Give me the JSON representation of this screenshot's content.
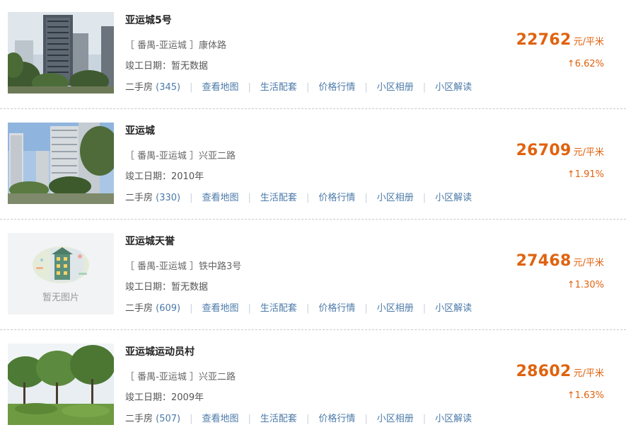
{
  "listings": [
    {
      "name": "亚运城5号",
      "address": "［ 番禺-亚运城 ］康体路",
      "date_label": "竣工日期：暂无数据",
      "price": "22762",
      "unit": "元/平米",
      "change": "↑6.62%",
      "secondhand_label": "二手房",
      "secondhand_count": "(345)",
      "image": "photo-tower"
    },
    {
      "name": "亚运城",
      "address": "［ 番禺-亚运城 ］兴亚二路",
      "date_label": "竣工日期：2010年",
      "price": "26709",
      "unit": "元/平米",
      "change": "↑1.91%",
      "secondhand_label": "二手房",
      "secondhand_count": "(330)",
      "image": "photo-highrises"
    },
    {
      "name": "亚运城天誉",
      "address": "［ 番禺-亚运城 ］铁中路3号",
      "date_label": "竣工日期：暂无数据",
      "price": "27468",
      "unit": "元/平米",
      "change": "↑1.30%",
      "secondhand_label": "二手房",
      "secondhand_count": "(609)",
      "image": "no-image",
      "image_placeholder": "暂无图片"
    },
    {
      "name": "亚运城运动员村",
      "address": "［ 番禺-亚运城 ］兴亚二路",
      "date_label": "竣工日期：2009年",
      "price": "28602",
      "unit": "元/平米",
      "change": "↑1.63%",
      "secondhand_label": "二手房",
      "secondhand_count": "(507)",
      "image": "photo-trees"
    }
  ],
  "links": {
    "map": "查看地图",
    "life": "生活配套",
    "price_trend": "价格行情",
    "album": "小区相册",
    "analysis": "小区解读"
  },
  "colors": {
    "price": "#e0620e",
    "link": "#4b7aa8",
    "divider": "#c9c9c9"
  }
}
